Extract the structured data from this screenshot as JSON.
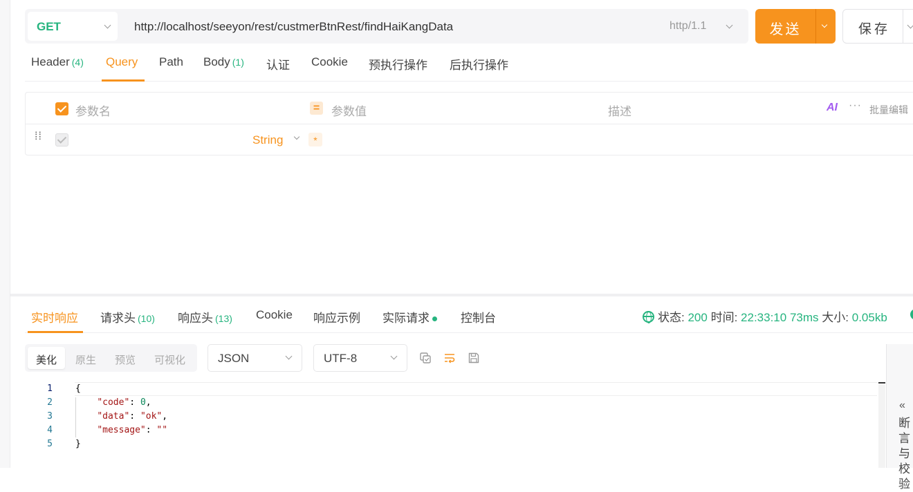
{
  "request": {
    "method": "GET",
    "url": "http://localhost/seeyon/rest/custmerBtnRest/findHaiKangData",
    "protocol": "http/1.1",
    "send_label": "发送",
    "save_label": "保存"
  },
  "request_tabs": [
    {
      "label": "Header",
      "count": "(4)"
    },
    {
      "label": "Query",
      "count": ""
    },
    {
      "label": "Path",
      "count": ""
    },
    {
      "label": "Body",
      "count": "(1)"
    },
    {
      "label": "认证",
      "count": ""
    },
    {
      "label": "Cookie",
      "count": ""
    },
    {
      "label": "预执行操作",
      "count": ""
    },
    {
      "label": "后执行操作",
      "count": ""
    }
  ],
  "active_request_tab": "Query",
  "params_table": {
    "col_name": "参数名",
    "col_value": "参数值",
    "col_desc": "描述",
    "ai_label": "AI",
    "more_label": "···",
    "bulk_edit_label": "批量编辑",
    "rows": [
      {
        "type": "String",
        "required_mark": "*"
      }
    ]
  },
  "response_tabs": [
    {
      "label": "实时响应",
      "count": ""
    },
    {
      "label": "请求头",
      "count": "(10)"
    },
    {
      "label": "响应头",
      "count": "(13)"
    },
    {
      "label": "Cookie",
      "count": ""
    },
    {
      "label": "响应示例",
      "count": ""
    },
    {
      "label": "实际请求",
      "count": ""
    },
    {
      "label": "控制台",
      "count": ""
    }
  ],
  "active_response_tab": "实时响应",
  "response_status": {
    "status_label": "状态:",
    "status_value": "200",
    "time_label": "时间:",
    "time_value": "22:33:10",
    "duration_value": "73ms",
    "size_label": "大小:",
    "size_value": "0.05kb"
  },
  "view_modes": [
    "美化",
    "原生",
    "预览",
    "可视化"
  ],
  "active_view_mode": "美化",
  "format_select": "JSON",
  "encoding_select": "UTF-8",
  "code_lines": [
    {
      "num": "1",
      "text": "{"
    },
    {
      "num": "2",
      "text": "    \"code\": 0,"
    },
    {
      "num": "3",
      "text": "    \"data\": \"ok\","
    },
    {
      "num": "4",
      "text": "    \"message\": \"\""
    },
    {
      "num": "5",
      "text": "}"
    }
  ],
  "side_panel": {
    "collapse_icon": "«",
    "label": "断言与校验"
  },
  "colors": {
    "accent": "#f7931e",
    "success": "#26b47f"
  }
}
